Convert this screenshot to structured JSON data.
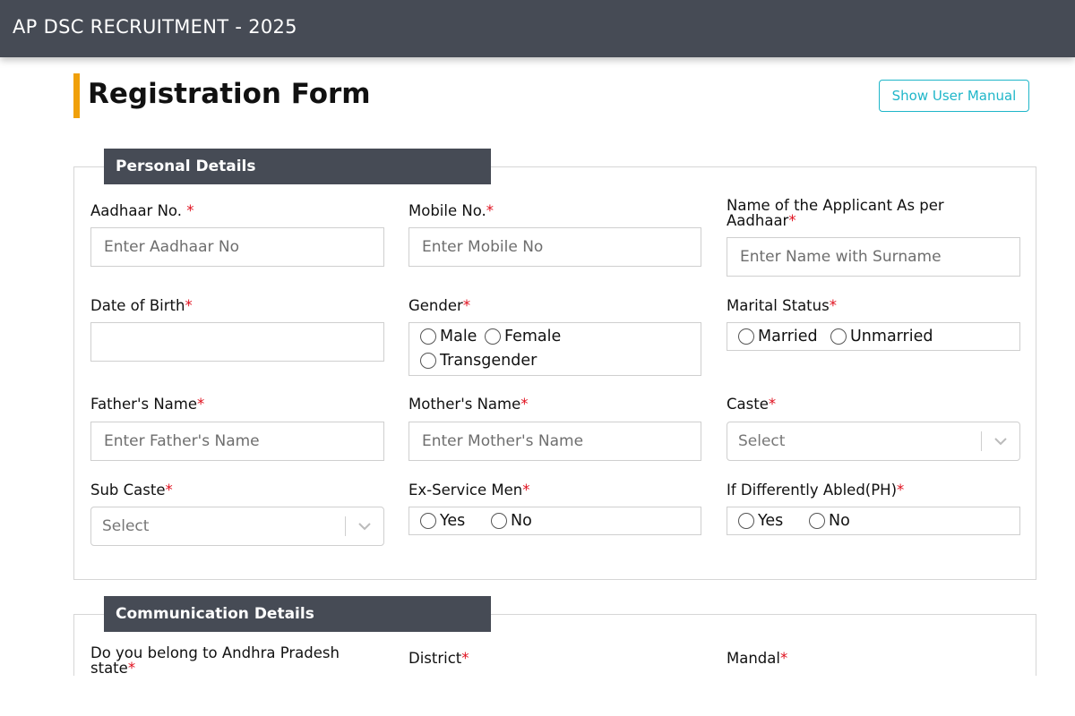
{
  "header": {
    "title": "AP DSC RECRUITMENT - 2025"
  },
  "page": {
    "title": "Registration Form",
    "manual_button": "Show User Manual"
  },
  "personal": {
    "section_title": "Personal Details",
    "aadhaar": {
      "label": "Aadhaar No. ",
      "required": "*",
      "placeholder": "Enter Aadhaar No",
      "value": ""
    },
    "mobile": {
      "label": "Mobile No.",
      "required": "*",
      "placeholder": "Enter Mobile No",
      "value": ""
    },
    "applicant_name": {
      "label_line1": "Name of the Applicant As per",
      "label_line2": "Aadhaar",
      "required": "*",
      "placeholder": "Enter Name with Surname",
      "value": ""
    },
    "dob": {
      "label": "Date of Birth",
      "required": "*",
      "value": ""
    },
    "gender": {
      "label": "Gender",
      "required": "*",
      "options": [
        "Male",
        "Female",
        "Transgender"
      ]
    },
    "marital": {
      "label": "Marital Status",
      "required": "*",
      "options": [
        "Married",
        "Unmarried"
      ]
    },
    "father": {
      "label": "Father's Name",
      "required": "*",
      "placeholder": "Enter Father's Name",
      "value": ""
    },
    "mother": {
      "label": "Mother's Name",
      "required": "*",
      "placeholder": "Enter Mother's Name",
      "value": ""
    },
    "caste": {
      "label": "Caste",
      "required": "*",
      "selected": "Select"
    },
    "sub_caste": {
      "label": "Sub Caste",
      "required": "*",
      "selected": "Select"
    },
    "ex_service": {
      "label": "Ex-Service Men",
      "required": "*",
      "options": [
        "Yes",
        "No"
      ]
    },
    "differently_abled": {
      "label": "If Differently Abled(PH)",
      "required": "*",
      "options": [
        "Yes",
        "No"
      ]
    }
  },
  "communication": {
    "section_title": "Communication Details",
    "ap_state": {
      "label_line1": "Do you belong to Andhra Pradesh",
      "label_line2": "state",
      "required": "*"
    },
    "district": {
      "label": "District",
      "required": "*"
    },
    "mandal": {
      "label": "Mandal",
      "required": "*"
    }
  },
  "colors": {
    "header_bg": "#464b55",
    "accent": "#f0a00a",
    "link": "#1fb6c9",
    "required": "#e0101e"
  },
  "icons": {
    "select_arrow": "chevron-down-icon",
    "radio": "radio-circle-icon"
  }
}
